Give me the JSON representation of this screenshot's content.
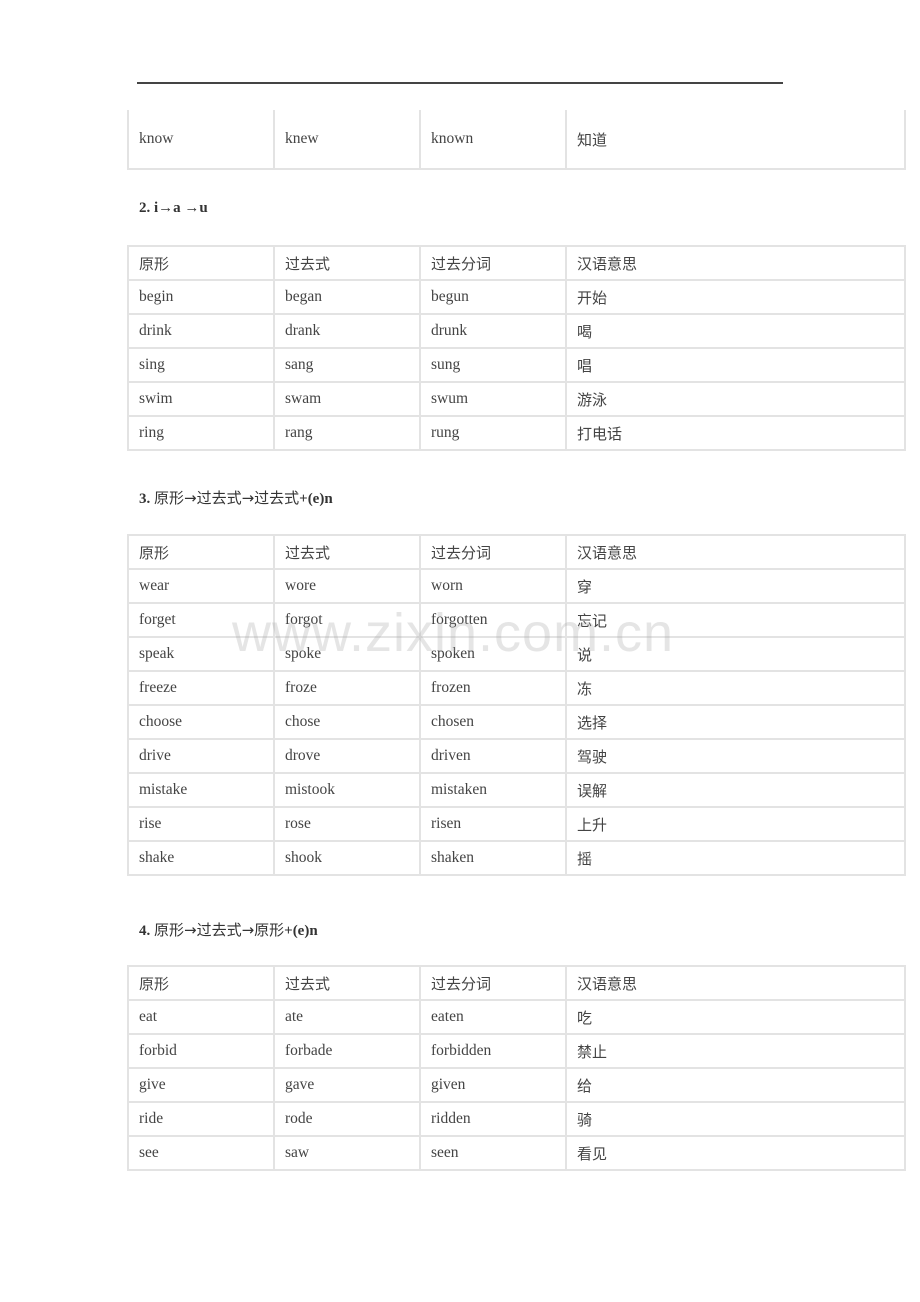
{
  "columns": [
    "原形",
    "过去式",
    "过去分词",
    "汉语意思"
  ],
  "section1_tail": {
    "rows": [
      [
        "know",
        "knew",
        "known",
        "知道"
      ]
    ]
  },
  "section2": {
    "heading": "2. i→a  →u",
    "rows": [
      [
        "begin",
        "began",
        "begun",
        "开始"
      ],
      [
        "drink",
        "drank",
        "drunk",
        "喝"
      ],
      [
        "sing",
        "sang",
        "sung",
        "唱"
      ],
      [
        "swim",
        "swam",
        "swum",
        "游泳"
      ],
      [
        "ring",
        "rang",
        "rung",
        "打电话"
      ]
    ]
  },
  "section3": {
    "heading_num": "3.",
    "heading_text": "原形→过去式→过去式",
    "heading_suffix": "+(e)n",
    "rows": [
      [
        "wear",
        "wore",
        "worn",
        "穿"
      ],
      [
        "forget",
        "forgot",
        "forgotten",
        "忘记"
      ],
      [
        "speak",
        "spoke",
        "spoken",
        "说"
      ],
      [
        "freeze",
        "froze",
        "frozen",
        "冻"
      ],
      [
        "choose",
        "chose",
        "chosen",
        "选择"
      ],
      [
        "drive",
        "drove",
        "driven",
        "驾驶"
      ],
      [
        "mistake",
        "mistook",
        "mistaken",
        "误解"
      ],
      [
        "rise",
        "rose",
        "risen",
        "上升"
      ],
      [
        "shake",
        "shook",
        "shaken",
        "摇"
      ]
    ]
  },
  "section4": {
    "heading_num": "4.",
    "heading_text": "原形→过去式→原形",
    "heading_suffix": "+(e)n",
    "rows": [
      [
        "eat",
        "ate",
        "eaten",
        "吃"
      ],
      [
        "forbid",
        "forbade",
        "forbidden",
        "禁止"
      ],
      [
        "give",
        "gave",
        "given",
        "给"
      ],
      [
        "ride",
        "rode",
        "ridden",
        "骑"
      ],
      [
        "see",
        "saw",
        "seen",
        "看见"
      ]
    ]
  },
  "watermark": "www.zixin.com.cn"
}
